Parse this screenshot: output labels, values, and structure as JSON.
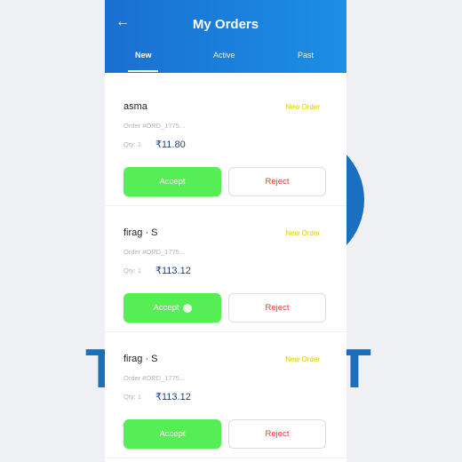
{
  "background": {
    "text_left": "T",
    "text_right": "T",
    "accent": "#1b6fbf"
  },
  "header": {
    "back_icon": "arrow-left",
    "title": "My Orders",
    "tabs": [
      {
        "label": "New",
        "active": true
      },
      {
        "label": "Active",
        "active": false
      },
      {
        "label": "Past",
        "active": false
      }
    ],
    "gradient": [
      "#1a6fd0",
      "#1b8ee6"
    ]
  },
  "orders": [
    {
      "customer": "asma",
      "status": "New Order",
      "order_no": "Order #ORD_1775...",
      "qty": "Qty: 1",
      "price": "₹11.80",
      "accept": "Accept",
      "reject": "Reject"
    },
    {
      "customer": "firag · S",
      "status": "New Order",
      "order_no": "Order #ORD_1775...",
      "qty": "Qty: 1",
      "price": "₹113.12",
      "accept": "Accept",
      "reject": "Reject"
    },
    {
      "customer": "firag · S",
      "status": "New Order",
      "order_no": "Order #ORD_1775...",
      "qty": "Qty: 1",
      "price": "₹113.12",
      "accept": "Accept",
      "reject": "Reject"
    }
  ],
  "colors": {
    "accept": "#55ee55",
    "reject_text": "#e53935",
    "status": "#e3c800",
    "price": "#1d3f8c"
  }
}
